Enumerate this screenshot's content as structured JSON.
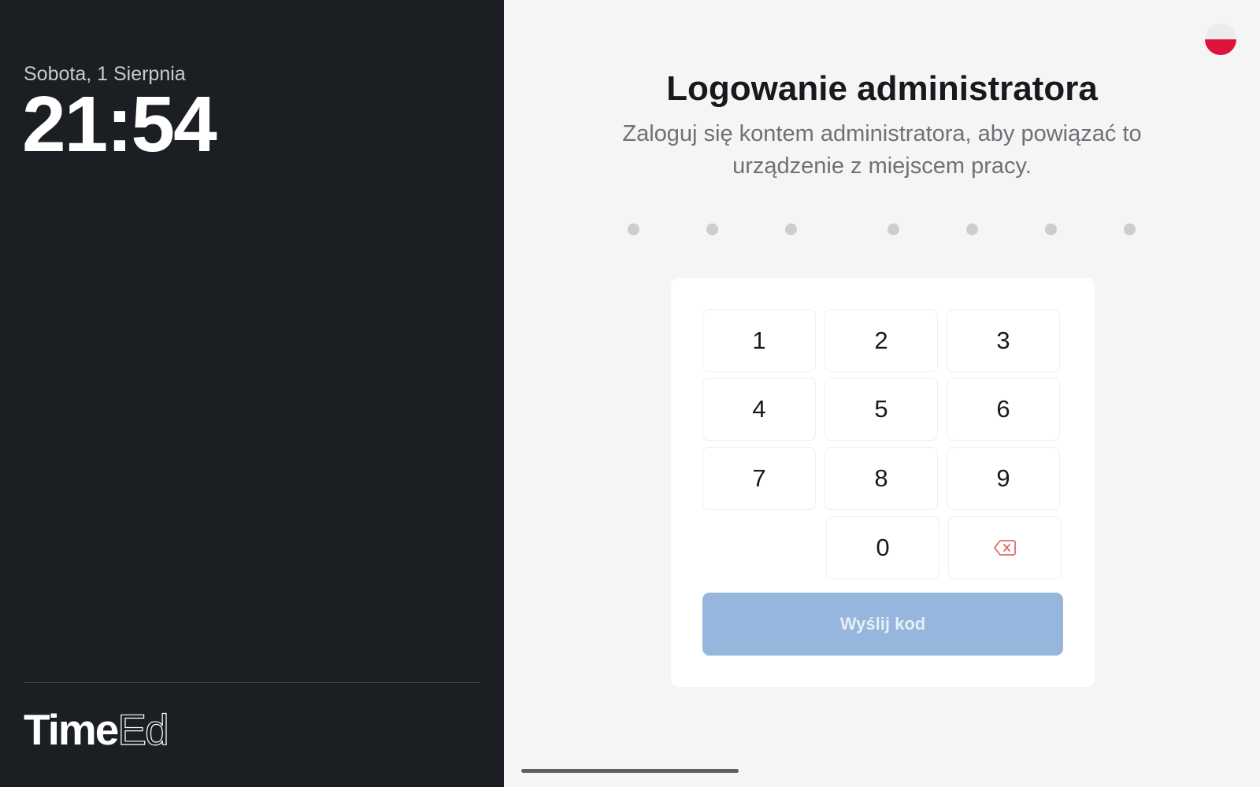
{
  "sidebar": {
    "date": "Sobota, 1 Sierpnia",
    "time": "21:54",
    "brand_bold": "Time",
    "brand_light": "Ed"
  },
  "language": {
    "flag_icon": "poland-flag-icon"
  },
  "main": {
    "title": "Logowanie administratora",
    "subtitle": "Zaloguj się kontem administratora, aby powiązać to urządzenie z miejscem pracy.",
    "code_length": 7,
    "entered_digits": 0
  },
  "keypad": {
    "keys": [
      "1",
      "2",
      "3",
      "4",
      "5",
      "6",
      "7",
      "8",
      "9",
      "0"
    ],
    "backspace_icon": "backspace-icon",
    "submit_label": "Wyślij kod"
  },
  "colors": {
    "sidebar_bg": "#1b1e22",
    "submit_disabled": "#96b6dd",
    "backspace": "#e06a6a",
    "flag_red": "#dc143c"
  }
}
